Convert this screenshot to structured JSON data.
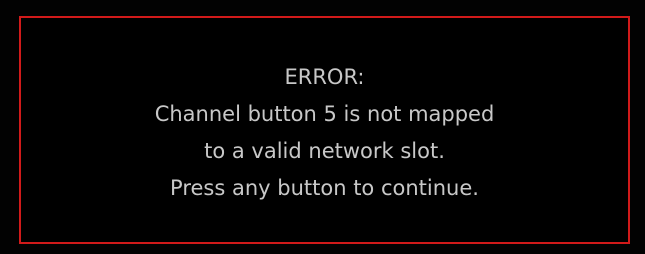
{
  "dialog": {
    "title": "ERROR:",
    "lines": [
      "Channel button 5 is not mapped",
      "to a valid network slot.",
      "Press any button to continue."
    ]
  },
  "colors": {
    "background": "#000000",
    "border": "#d11a1a",
    "text": "#c8c8c8"
  }
}
